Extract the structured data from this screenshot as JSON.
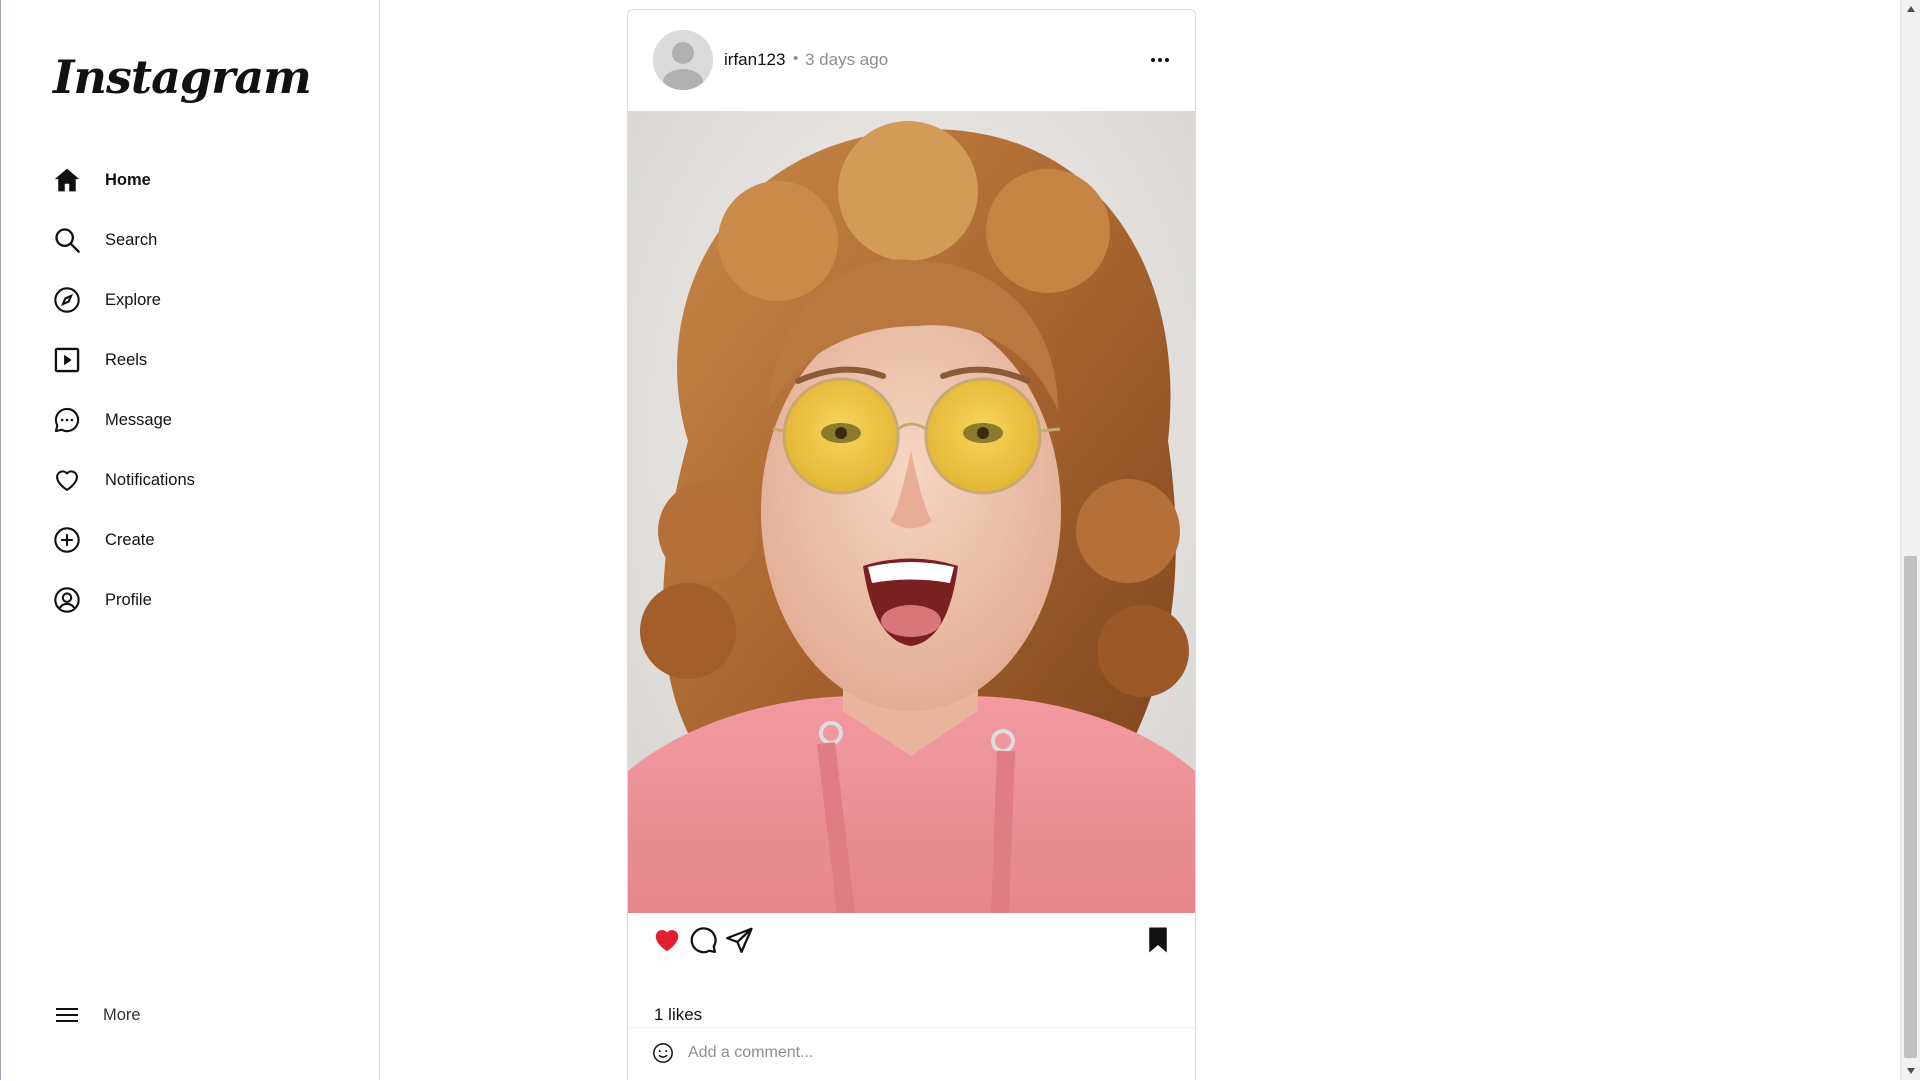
{
  "app": {
    "logo_text": "Instagram"
  },
  "sidebar": {
    "items": [
      {
        "label": "Home",
        "icon": "home-icon",
        "active": true
      },
      {
        "label": "Search",
        "icon": "search-icon"
      },
      {
        "label": "Explore",
        "icon": "compass-icon"
      },
      {
        "label": "Reels",
        "icon": "reels-icon"
      },
      {
        "label": "Message",
        "icon": "message-icon"
      },
      {
        "label": "Notifications",
        "icon": "heart-icon"
      },
      {
        "label": "Create",
        "icon": "plus-circle-icon"
      },
      {
        "label": "Profile",
        "icon": "profile-icon"
      }
    ],
    "more_label": "More"
  },
  "post": {
    "username": "irfan123",
    "separator": "•",
    "time_ago": "3 days ago",
    "image_description": "photo",
    "liked": true,
    "saved": true,
    "likes_text": "1 likes",
    "comment_placeholder": "Add a comment..."
  },
  "colors": {
    "like_red": "#e0202e",
    "text": "#111111",
    "muted": "#8e8e8e",
    "border": "#dbdbdb"
  }
}
